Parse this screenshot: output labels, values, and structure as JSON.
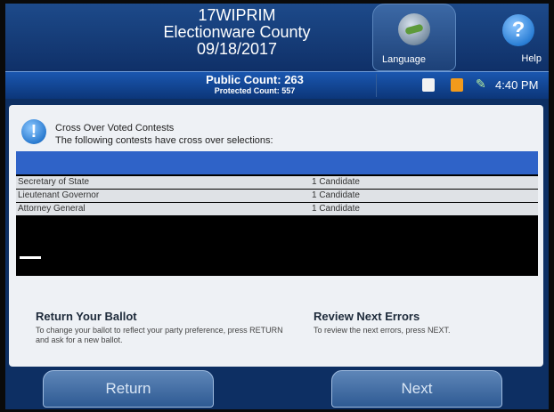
{
  "header": {
    "title_line1": "17WIPRIM",
    "title_line2": "Electionware County",
    "title_line3": "09/18/2017",
    "language_label": "Language",
    "help_label": "Help"
  },
  "status": {
    "public_count": "Public Count: 263",
    "protected_count": "Protected Count: 557",
    "time": "4:40 PM"
  },
  "message": {
    "line1": "Cross Over Voted Contests",
    "line2": "The following contests have cross over selections:"
  },
  "contests": [
    {
      "name": "Secretary of State",
      "selection": "1 Candidate"
    },
    {
      "name": "Lieutenant Governor",
      "selection": "1 Candidate"
    },
    {
      "name": "Attorney General",
      "selection": "1 Candidate"
    }
  ],
  "sections": {
    "return_title": "Return Your Ballot",
    "return_text": "To change your ballot to reflect your party preference, press RETURN and ask for a new ballot.",
    "review_title": "Review Next Errors",
    "review_text": "To review the next errors, press NEXT."
  },
  "buttons": {
    "return_label": "Return",
    "next_label": "Next"
  },
  "icons": {
    "language": "language-icon",
    "help": "help-icon",
    "alert": "alert-icon"
  }
}
